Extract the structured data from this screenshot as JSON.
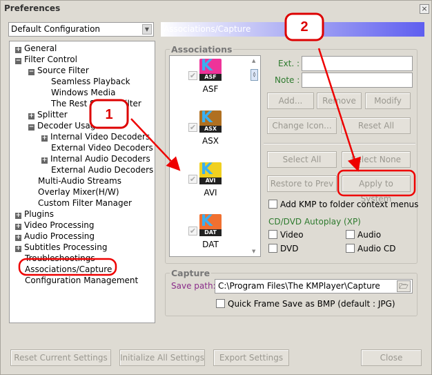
{
  "window": {
    "title": "Preferences",
    "close": "×"
  },
  "config": {
    "selected": "Default Configuration"
  },
  "tree": [
    {
      "label": "General",
      "pm": "+",
      "indent": 0
    },
    {
      "label": "Filter Control",
      "pm": "−",
      "indent": 0
    },
    {
      "label": "Source Filter",
      "pm": "−",
      "indent": 1
    },
    {
      "label": "Seamless Playback",
      "pm": "",
      "indent": 2
    },
    {
      "label": "Windows Media",
      "pm": "",
      "indent": 2
    },
    {
      "label": "The Rest Source Filter",
      "pm": "",
      "indent": 2
    },
    {
      "label": "Splitter",
      "pm": "+",
      "indent": 1
    },
    {
      "label": "Decoder Usage",
      "pm": "−",
      "indent": 1
    },
    {
      "label": "Internal Video Decoders",
      "pm": "+",
      "indent": 2
    },
    {
      "label": "External Video Decoders",
      "pm": "",
      "indent": 2
    },
    {
      "label": "Internal Audio Decoders",
      "pm": "+",
      "indent": 2
    },
    {
      "label": "External Audio Decoders",
      "pm": "",
      "indent": 2
    },
    {
      "label": "Multi-Audio Streams",
      "pm": "",
      "indent": 1
    },
    {
      "label": "Overlay Mixer(H/W)",
      "pm": "",
      "indent": 1
    },
    {
      "label": "Custom Filter Manager",
      "pm": "",
      "indent": 1
    },
    {
      "label": "Plugins",
      "pm": "+",
      "indent": 0
    },
    {
      "label": "Video Processing",
      "pm": "+",
      "indent": 0
    },
    {
      "label": "Audio Processing",
      "pm": "+",
      "indent": 0
    },
    {
      "label": "Subtitles Processing",
      "pm": "+",
      "indent": 0
    },
    {
      "label": "Troubleshootings",
      "pm": "",
      "indent": 0
    },
    {
      "label": "Associations/Capture",
      "pm": "",
      "indent": 0
    },
    {
      "label": "Configuration Management",
      "pm": "",
      "indent": 0
    }
  ],
  "header": "Associations/Capture",
  "associations": {
    "title": "Associations",
    "files": [
      {
        "ext": "ASF",
        "color": "#ee3399"
      },
      {
        "ext": "ASX",
        "color": "#b07020"
      },
      {
        "ext": "AVI",
        "color": "#f0d020"
      },
      {
        "ext": "DAT",
        "color": "#f07030"
      }
    ],
    "ext_label": "Ext. :",
    "note_label": "Note :",
    "ext_value": "",
    "note_value": "",
    "buttons": {
      "add": "Add...",
      "remove": "Remove",
      "modify": "Modify",
      "change_icon": "Change Icon...",
      "reset_all": "Reset All",
      "select_all": "Select All",
      "select_none": "Select None",
      "restore": "Restore to Prev",
      "apply": "Apply to System"
    },
    "folder_context": "Add KMP to folder context menus",
    "autoplay_title": "CD/DVD Autoplay (XP)",
    "autoplay": {
      "video": "Video",
      "audio": "Audio",
      "dvd": "DVD",
      "audio_cd": "Audio CD"
    }
  },
  "capture": {
    "title": "Capture",
    "save_path_label": "Save path:",
    "save_path": "C:\\Program Files\\The KMPlayer\\Capture",
    "quick_frame": "Quick Frame Save as BMP (default : JPG)"
  },
  "footer": {
    "reset": "Reset Current Settings",
    "initialize": "Initialize All Settings",
    "export": "Export Settings",
    "close": "Close"
  },
  "annotations": {
    "one": "1",
    "two": "2"
  }
}
